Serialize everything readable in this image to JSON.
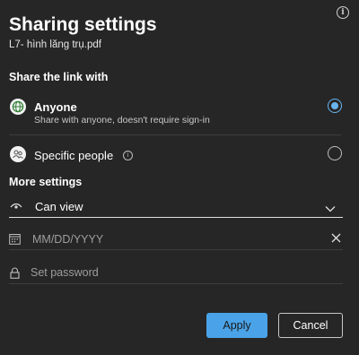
{
  "dialog": {
    "title": "Sharing settings",
    "file_name": "L7- hình lăng trụ.pdf",
    "info_glyph": "i"
  },
  "share_section": {
    "label": "Share the link with",
    "options": [
      {
        "title": "Anyone",
        "description": "Share with anyone, doesn't require sign-in",
        "icon": "globe-icon",
        "selected": true
      },
      {
        "title": "Specific people",
        "description": "",
        "icon": "people-icon",
        "selected": false
      }
    ]
  },
  "more_settings": {
    "label": "More settings",
    "permission": {
      "value": "Can view",
      "icon": "eye-icon"
    },
    "expiry": {
      "placeholder": "MM/DD/YYYY",
      "icon": "calendar-icon"
    },
    "password": {
      "placeholder": "Set password",
      "icon": "lock-icon"
    }
  },
  "buttons": {
    "apply": "Apply",
    "cancel": "Cancel"
  },
  "colors": {
    "background": "#262626",
    "accent": "#69b4ee",
    "apply_button": "#4aa3e8"
  }
}
